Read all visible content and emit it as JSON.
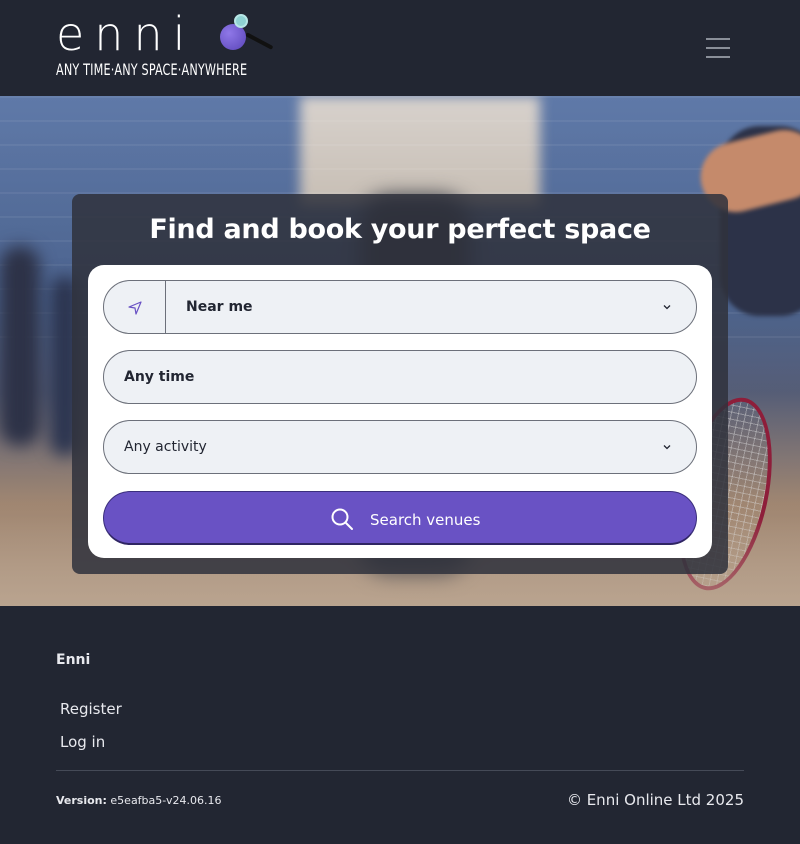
{
  "brand": {
    "wordmark": "enni",
    "tagline": "ANY TIME·ANY SPACE·ANYWHERE",
    "accent_color": "#6952c4"
  },
  "header": {
    "menu_icon": "hamburger-menu-icon"
  },
  "hero": {
    "title": "Find and book your perfect space",
    "location": {
      "icon": "location-arrow-icon",
      "value": "Near me",
      "chevron": "chevron-down-icon"
    },
    "time": {
      "value": "Any time"
    },
    "activity": {
      "value": "Any activity",
      "chevron": "chevron-down-icon"
    },
    "search_button": {
      "icon": "search-icon",
      "label": "Search venues"
    }
  },
  "footer": {
    "brand": "Enni",
    "links": [
      "Register",
      "Log in"
    ],
    "version_label": "Version:",
    "version_value": "e5eafba5-v24.06.16",
    "copyright": "© Enni Online Ltd 2025"
  }
}
